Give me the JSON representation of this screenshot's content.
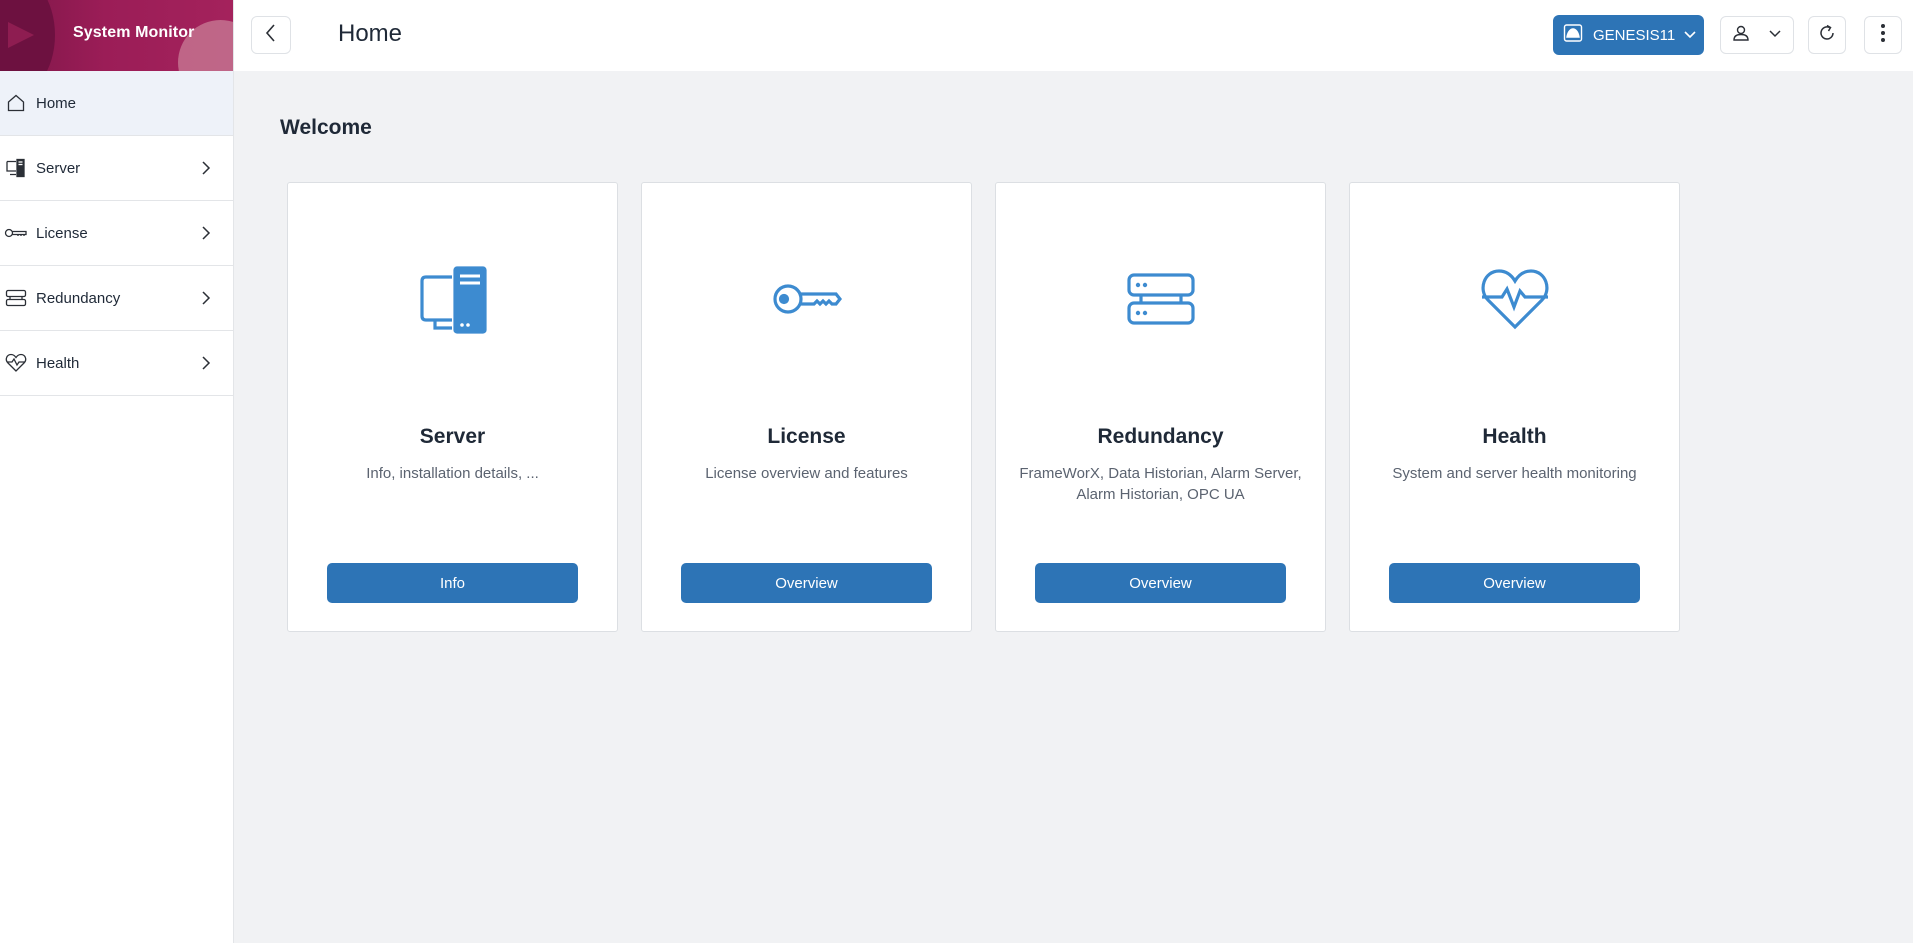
{
  "brand": {
    "title": "System Monitor"
  },
  "sidebar": {
    "items": [
      {
        "label": "Home",
        "icon": "home-icon",
        "active": true
      },
      {
        "label": "Server",
        "icon": "server-icon"
      },
      {
        "label": "License",
        "icon": "key-icon"
      },
      {
        "label": "Redundancy",
        "icon": "redundancy-icon"
      },
      {
        "label": "Health",
        "icon": "heartbeat-icon"
      }
    ]
  },
  "header": {
    "title": "Home",
    "server_name": "GENESIS11"
  },
  "main": {
    "welcome": "Welcome",
    "cards": [
      {
        "title": "Server",
        "description": "Info, installation details, ...",
        "button": "Info",
        "icon": "server-icon"
      },
      {
        "title": "License",
        "description": "License overview and features",
        "button": "Overview",
        "icon": "key-icon"
      },
      {
        "title": "Redundancy",
        "description": "FrameWorX, Data Historian, Alarm Server, Alarm Historian, OPC UA",
        "button": "Overview",
        "icon": "redundancy-icon"
      },
      {
        "title": "Health",
        "description": "System and server health monitoring",
        "button": "Overview",
        "icon": "heartbeat-icon"
      }
    ]
  },
  "colors": {
    "accent": "#2d74b6",
    "brand": "#9b1d57",
    "icon": "#3d8bd0"
  }
}
